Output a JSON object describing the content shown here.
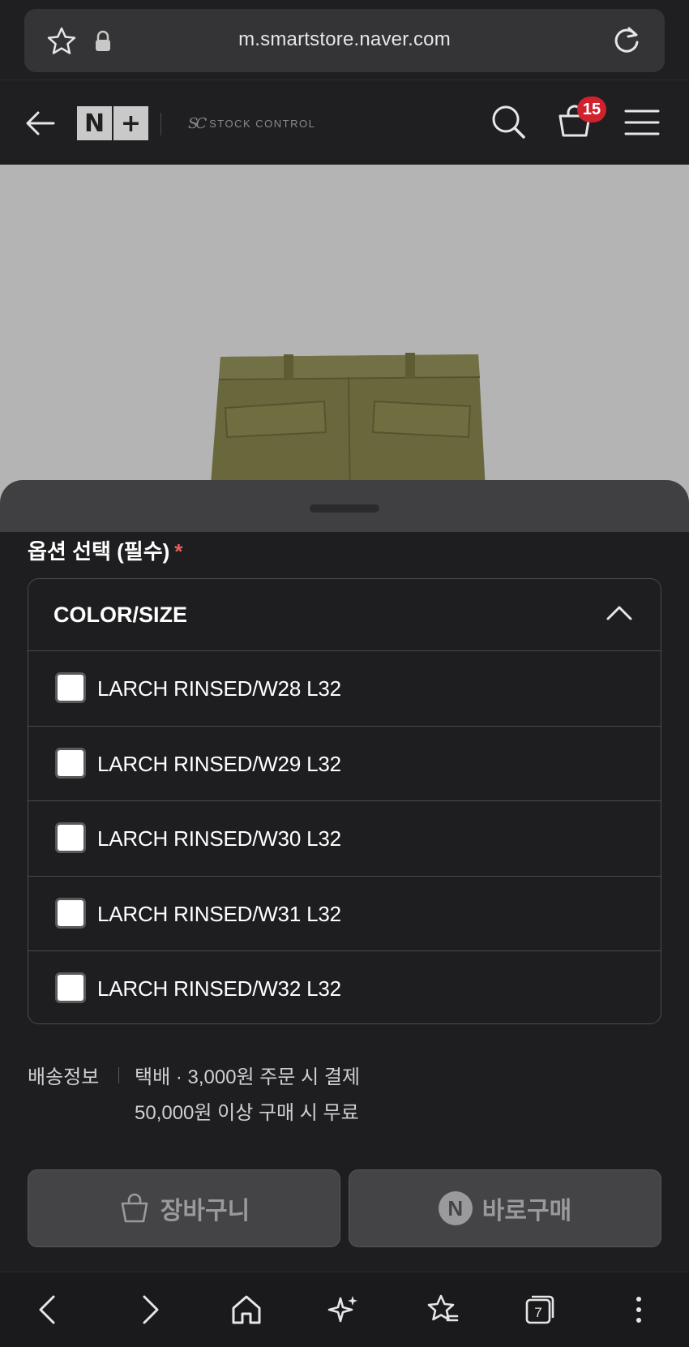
{
  "browser": {
    "url": "m.smartstore.naver.com",
    "tab_count": "7"
  },
  "header": {
    "logo_left": "N",
    "logo_right": "+",
    "brand_mark": "SC",
    "brand_name": "STOCK CONTROL",
    "cart_count": "15"
  },
  "options": {
    "title": "옵션 선택 (필수)",
    "required_mark": "*",
    "dropdown_label": "COLOR/SIZE",
    "items": [
      {
        "label": "LARCH RINSED/W28 L32"
      },
      {
        "label": "LARCH RINSED/W29 L32"
      },
      {
        "label": "LARCH RINSED/W30 L32"
      },
      {
        "label": "LARCH RINSED/W31 L32"
      },
      {
        "label": "LARCH RINSED/W32 L32"
      }
    ]
  },
  "shipping": {
    "label": "배송정보",
    "line1": "택배 · 3,000원 주문 시 결제",
    "line2": "50,000원 이상 구매 시 무료"
  },
  "actions": {
    "cart_label": "장바구니",
    "buy_icon_letter": "N",
    "buy_label": "바로구매"
  },
  "colors": {
    "background": "#1e1e20",
    "badge": "#d0212e",
    "required": "#f05a5a",
    "button": "#444446"
  }
}
